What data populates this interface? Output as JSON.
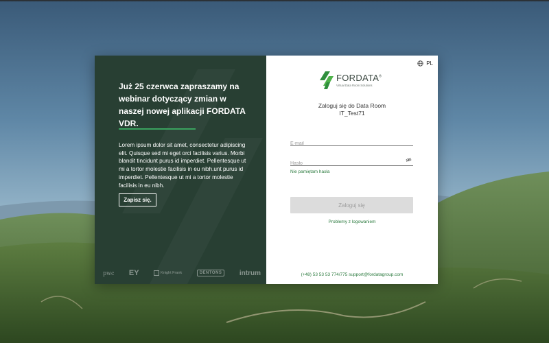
{
  "promo": {
    "title": "Już 25 czerwca zapraszamy na webinar dotyczący zmian w naszej nowej aplikacji FORDATA VDR.",
    "body": "Lorem ipsum dolor sit amet, consectetur adipiscing elit. Quisque sed mi eget orci facilisis varius. Morbi blandit tincidunt purus id imperdiet. Pellentesque ut mi a tortor molestie facilisis in eu nibh.unt purus id imperdiet. Pellentesque ut mi a tortor molestie facilisis in eu nibh.",
    "signup_label": "Zapisz się.",
    "partners": [
      "pwc",
      "EY",
      "Knight Frank",
      "DENTONS",
      "intrum"
    ]
  },
  "language": {
    "code": "PL",
    "icon": "globe-icon"
  },
  "logo": {
    "name": "FORDATA",
    "tagline": "Virtual Data Room Solutions",
    "trademark": "®"
  },
  "login": {
    "title_line1": "Zaloguj się do Data Room",
    "title_line2": "IT_Test71",
    "email_placeholder": "E-mail",
    "email_value": "",
    "password_placeholder": "Hasło",
    "password_value": "",
    "forgot_label": "Nie pamiętam hasła",
    "submit_label": "Zaloguj się",
    "problems_label": "Problemy z logowaniem"
  },
  "footer": {
    "phone": "(+48) 53 53 53 774/775",
    "email": "support@fordatagroup.com"
  },
  "colors": {
    "panel": "#283f33",
    "accent": "#3aa35f",
    "link": "#2b7a3e",
    "button_disabled": "#dcdcdc"
  }
}
